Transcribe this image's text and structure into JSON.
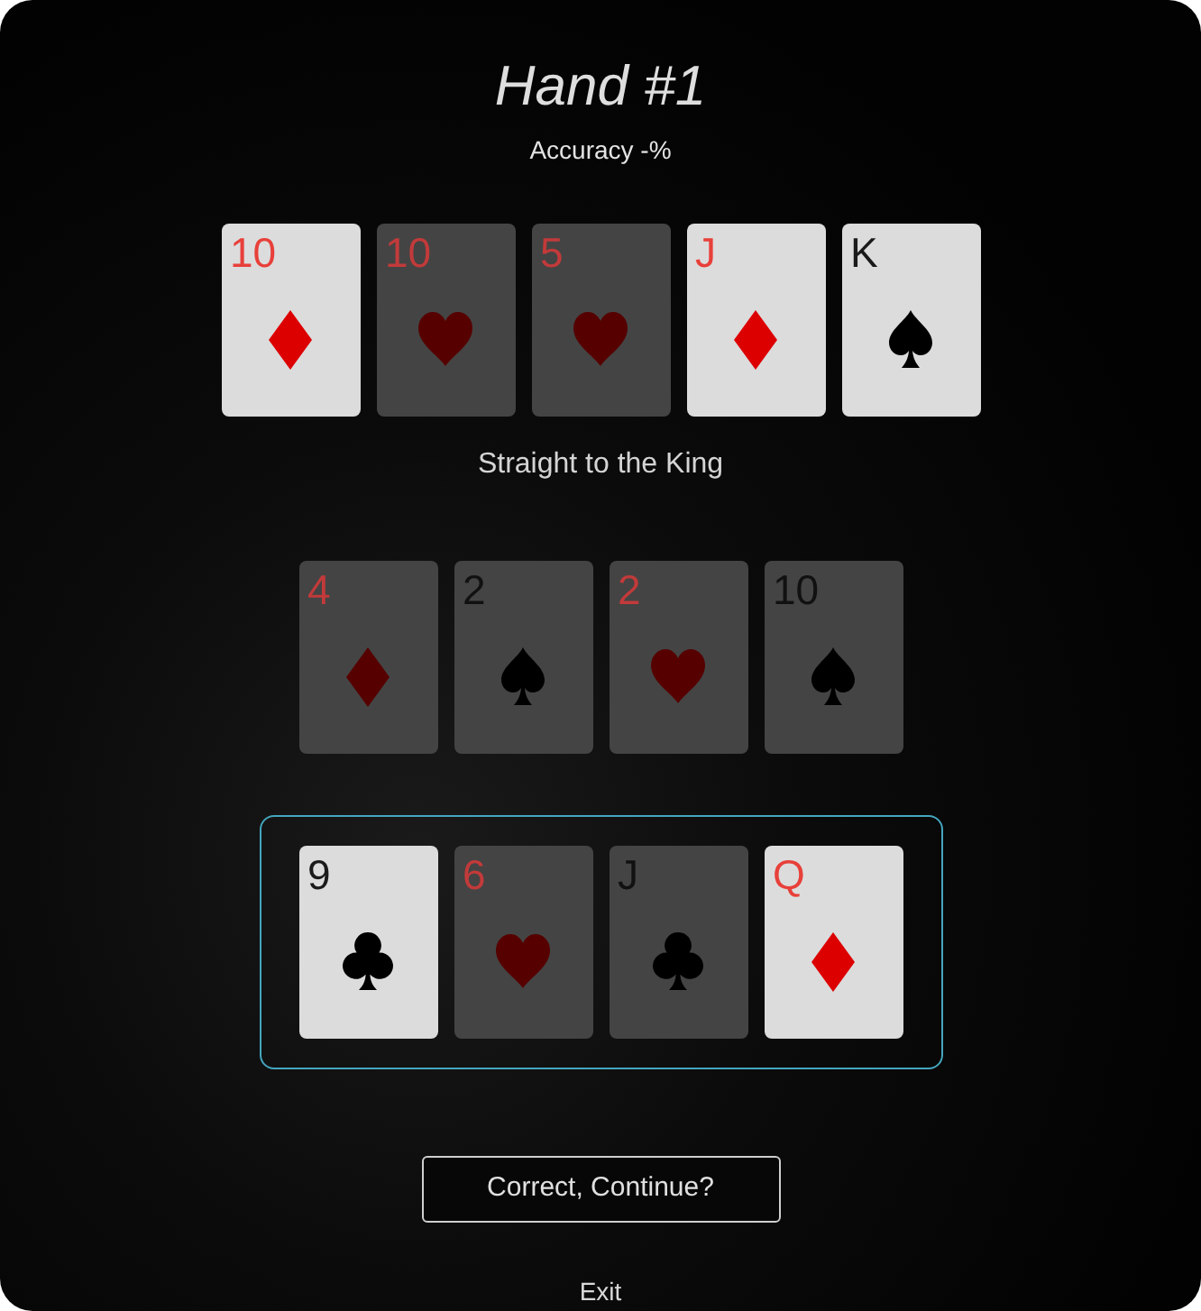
{
  "title": "Hand #1",
  "accuracy": "Accuracy -%",
  "board": [
    {
      "rank": "10",
      "kind": "diamonds",
      "highlighted": true
    },
    {
      "rank": "10",
      "kind": "hearts",
      "highlighted": false
    },
    {
      "rank": "5",
      "kind": "hearts",
      "highlighted": false
    },
    {
      "rank": "J",
      "kind": "diamonds",
      "highlighted": true
    },
    {
      "rank": "K",
      "kind": "spades",
      "highlighted": true
    }
  ],
  "hand_name": "Straight to the King",
  "hands": [
    {
      "selected": false,
      "cards": [
        {
          "rank": "4",
          "kind": "diamonds",
          "highlighted": false
        },
        {
          "rank": "2",
          "kind": "spades",
          "highlighted": false
        },
        {
          "rank": "2",
          "kind": "hearts",
          "highlighted": false
        },
        {
          "rank": "10",
          "kind": "spades",
          "highlighted": false
        }
      ]
    },
    {
      "selected": true,
      "cards": [
        {
          "rank": "9",
          "kind": "clubs",
          "highlighted": true
        },
        {
          "rank": "6",
          "kind": "hearts",
          "highlighted": false
        },
        {
          "rank": "J",
          "kind": "clubs",
          "highlighted": false
        },
        {
          "rank": "Q",
          "kind": "diamonds",
          "highlighted": true
        }
      ]
    }
  ],
  "continue_button": "Correct, Continue?",
  "exit_link": "Exit"
}
